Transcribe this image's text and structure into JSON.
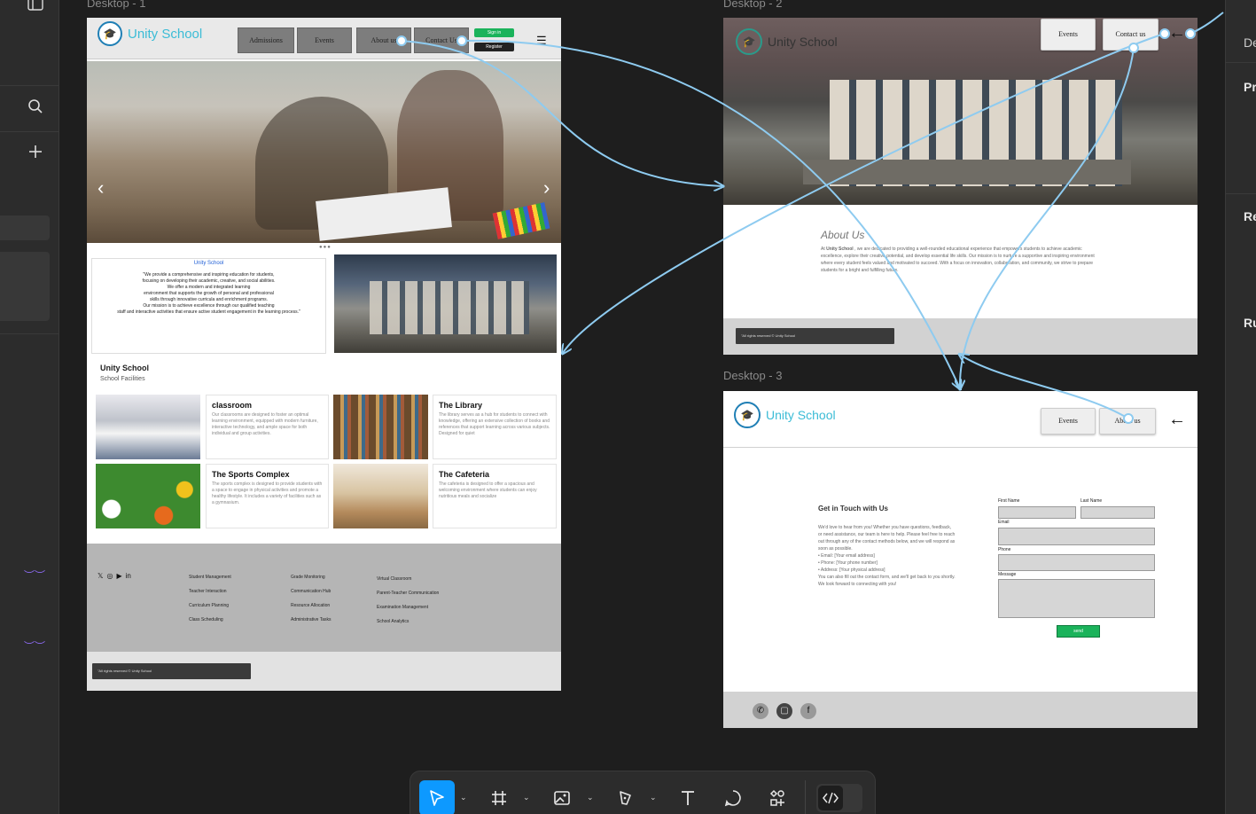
{
  "frames": {
    "d1": "Desktop - 1",
    "d2": "Desktop - 2",
    "d3": "Desktop - 3"
  },
  "brand": "Unity School",
  "d1": {
    "nav": [
      "Admissions",
      "Events",
      "About us",
      "Contact Us"
    ],
    "signin": "Sign in",
    "register": "Register",
    "mission_title": "Unity School",
    "mission_lines": [
      "\"We provide a comprehensive and inspiring education for students,",
      "focusing on developing their academic, creative, and social abilities.",
      "We offer a modern and integrated learning",
      "environment that supports the growth of personal and professional",
      "skills through innovative curricula and enrichment programs.",
      "Our mission is to achieve excellence through our qualified teaching",
      "staff and interactive activities that ensure active student engagement in the learning process.\""
    ],
    "facilities_title": "Unity School",
    "facilities_sub": "School Facilities",
    "cards": [
      {
        "title": "classroom",
        "body": "Our classrooms are designed to foster an optimal learning environment, equipped with modern furniture, interactive technology, and ample space for both individual and group activities."
      },
      {
        "title": "The Library",
        "body": "The library serves as a hub for students to connect with knowledge, offering an extensive collection of books and references that support learning across various subjects. Designed for quiet"
      },
      {
        "title": "The Sports Complex",
        "body": "The sports complex is designed to provide students with a space to engage in physical activities and promote a healthy lifestyle. It includes a variety of facilities such as a gymnasium."
      },
      {
        "title": "The Cafeteria",
        "body": "The cafeteria is designed to offer a spacious and welcoming environment where students can enjoy nutritious meals and socialize"
      }
    ],
    "footer_col1": [
      "Student Management",
      "Teacher Interaction",
      "Curriculum Planning",
      "Class Scheduling"
    ],
    "footer_col2": [
      "Grade Monitoring",
      "Communication Hub",
      "Resource Allocation",
      "Administrative Tasks"
    ],
    "footer_col3": [
      "Virtual Classroom",
      "Parent-Teacher Communication",
      "Examination Management",
      "School Analytics"
    ],
    "copyright": "\"All rights reserved © Unity School"
  },
  "d2": {
    "nav": [
      "Events",
      "Contact us"
    ],
    "about_title": "About Us",
    "about_body_pre": "At ",
    "about_body_bold": "Unity School",
    "about_body_post": " , we are dedicated to providing a well-rounded educational experience that empowers students to achieve academic excellence, explore their creative potential, and develop essential life skills. Our mission is to nurture a supportive and inspiring environment where every student feels valued and motivated to succeed. With a focus on innovation, collaboration, and community, we strive to prepare students for a bright and fulfilling future.",
    "copyright": "\"All rights reserved © Unity School"
  },
  "d3": {
    "nav": [
      "Events",
      "About us"
    ],
    "contact_title": "Get in Touch with Us",
    "contact_intro": "We'd love to hear from you! Whether you have questions, feedback, or need assistance, our team is here to help. Please feel free to reach out through any of the contact methods below, and we will respond as soon as possible.",
    "contact_items": [
      "Email: [Your email address]",
      "Phone: [Your phone number]",
      "Address: [Your physical address]"
    ],
    "contact_outro": "You can also fill out the contact form, and we'll get back to you shortly. We look forward to connecting with you!",
    "labels": {
      "first": "First Name",
      "last": "Last Name",
      "email": "Email",
      "phone": "Phone",
      "message": "Message"
    },
    "send": "send"
  },
  "right_panel": [
    "De",
    "Pr",
    "Re",
    "Ru"
  ],
  "toolbar": [
    "move-tool",
    "frame-tool",
    "image-tool",
    "pen-tool",
    "text-tool",
    "comment-tool",
    "components-tool",
    "dev-mode"
  ],
  "colors": {
    "accent": "#0d99ff",
    "link": "#8ecbf0",
    "brand": "#3bbcd6",
    "green": "#1bb35b"
  }
}
